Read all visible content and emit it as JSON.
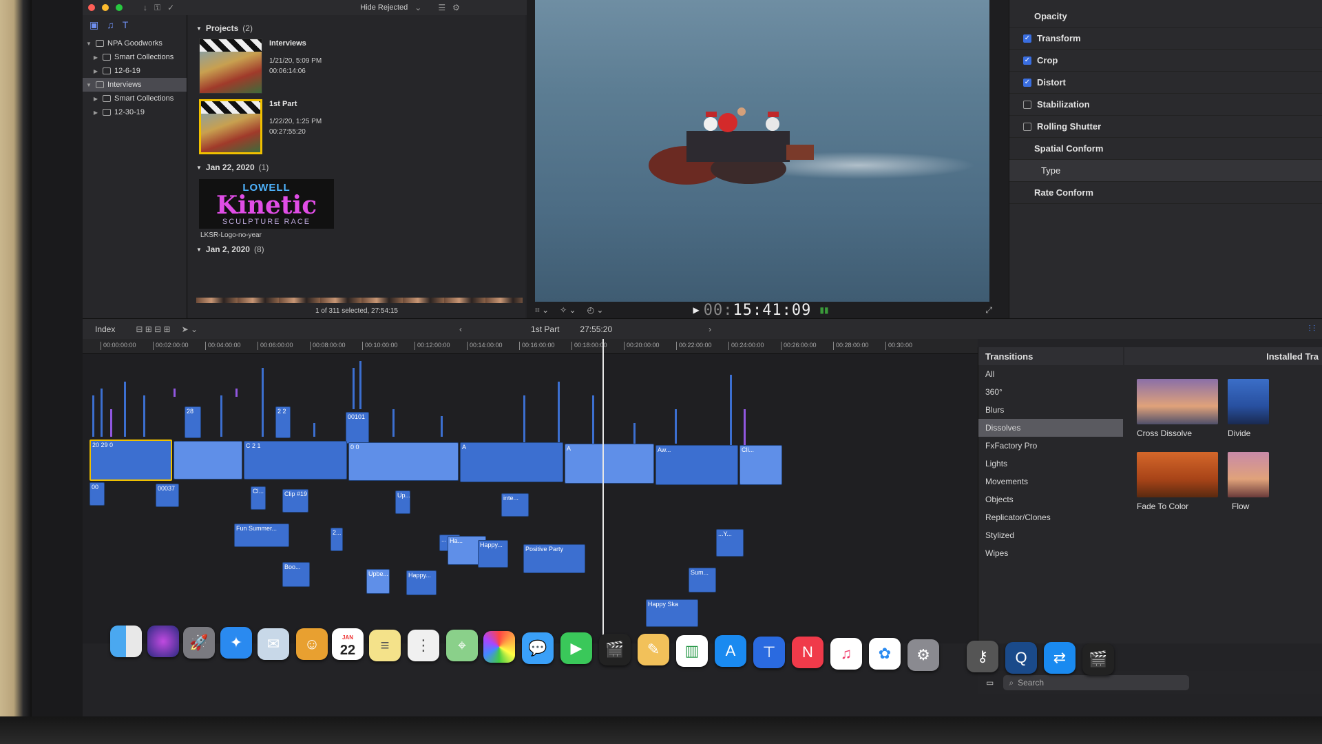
{
  "window": {
    "hide_rejected": "Hide Rejected"
  },
  "libraries": {
    "items": [
      {
        "label": "NPA Goodworks",
        "level": 0
      },
      {
        "label": "Smart Collections",
        "level": 1
      },
      {
        "label": "12-6-19",
        "level": 1
      },
      {
        "label": "Interviews",
        "level": 0
      },
      {
        "label": "Smart Collections",
        "level": 1
      },
      {
        "label": "12-30-19",
        "level": 1
      }
    ]
  },
  "browser": {
    "projects_heading": "Projects",
    "projects_count": "(2)",
    "projects": [
      {
        "name": "Interviews",
        "date": "1/21/20, 5:09 PM",
        "duration": "00:06:14:06"
      },
      {
        "name": "1st Part",
        "date": "1/22/20, 1:25 PM",
        "duration": "00:27:55:20"
      }
    ],
    "group_jan22": {
      "heading": "Jan 22, 2020",
      "count": "(1)"
    },
    "logo": {
      "top": "LOWELL",
      "mid": "Kinetic",
      "bottom": "SCULPTURE RACE"
    },
    "logo_clip_name": "LKSR-Logo-no-year",
    "group_jan2": {
      "heading": "Jan 2, 2020",
      "count": "(8)"
    },
    "status": "1 of 311 selected, 27:54:15"
  },
  "viewer": {
    "timecode_prefix": "00:",
    "timecode": "15:41:09"
  },
  "inspector": {
    "rows": [
      {
        "label": "Opacity",
        "checkbox": null
      },
      {
        "label": "Transform",
        "checkbox": true
      },
      {
        "label": "Crop",
        "checkbox": true
      },
      {
        "label": "Distort",
        "checkbox": true
      },
      {
        "label": "Stabilization",
        "checkbox": false
      },
      {
        "label": "Rolling Shutter",
        "checkbox": false
      },
      {
        "label": "Spatial Conform",
        "checkbox": null
      },
      {
        "label": "Type",
        "checkbox": null
      },
      {
        "label": "Rate Conform",
        "checkbox": null
      }
    ]
  },
  "timeline": {
    "index_label": "Index",
    "project_name": "1st Part",
    "project_duration": "27:55:20",
    "ruler": [
      "00:00:00:00",
      "00:02:00:00",
      "00:04:00:00",
      "00:06:00:00",
      "00:08:00:00",
      "00:10:00:00",
      "00:12:00:00",
      "00:14:00:00",
      "00:16:00:00",
      "00:18:00:00",
      "00:20:00:00",
      "00:22:00:00",
      "00:24:00:00",
      "00:26:00:00",
      "00:28:00:00",
      "00:30:00"
    ],
    "clip_labels": {
      "c1": "00101",
      "c2": "00037",
      "c3": "Clip #19",
      "c4": "Fun Summer...",
      "c5": "Positive Party",
      "c6": "Happy...",
      "c7": "Happy Ska",
      "c8": "Sum...",
      "c9": "Boo...",
      "c10": "Upbe...",
      "c11": "inte...",
      "c12": "Aw...",
      "c13": "Cli...",
      "c14": "Up...",
      "c15": "Ha..."
    }
  },
  "transitions": {
    "heading": "Transitions",
    "installed_heading": "Installed Tra",
    "categories": [
      "All",
      "360°",
      "Blurs",
      "Dissolves",
      "FxFactory Pro",
      "Lights",
      "Movements",
      "Objects",
      "Replicator/Clones",
      "Stylized",
      "Wipes"
    ],
    "selected_category": "Dissolves",
    "effects": [
      "Cross Dissolve",
      "Divide",
      "Fade To Color",
      "Flow"
    ],
    "search_placeholder": "Search"
  },
  "dock": {
    "calendar_month": "JAN",
    "calendar_day": "22"
  },
  "colors": {
    "accent": "#3c6fd0",
    "selection": "#f0c000",
    "clip_purple": "#8a55d6"
  }
}
